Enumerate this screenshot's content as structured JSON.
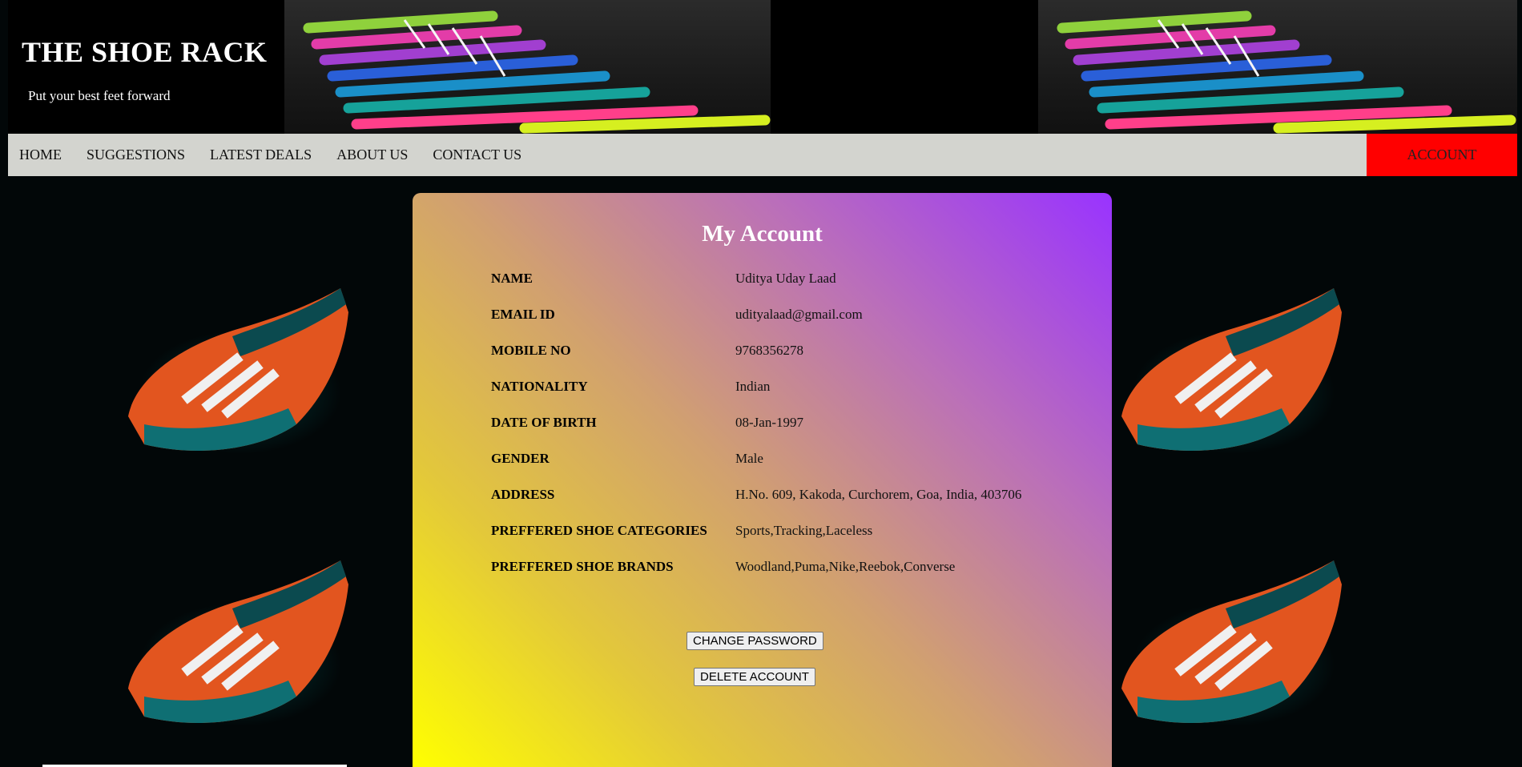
{
  "header": {
    "title": "THE SHOE RACK",
    "tagline": "Put your best feet forward"
  },
  "nav": {
    "items": [
      {
        "label": "HOME"
      },
      {
        "label": "SUGGESTIONS"
      },
      {
        "label": "LATEST DEALS"
      },
      {
        "label": "ABOUT US"
      },
      {
        "label": "CONTACT US"
      }
    ],
    "account_label": "ACCOUNT"
  },
  "account": {
    "title": "My Account",
    "fields": [
      {
        "label": "NAME",
        "value": "Uditya Uday Laad"
      },
      {
        "label": "EMAIL ID",
        "value": "udityalaad@gmail.com"
      },
      {
        "label": "MOBILE NO",
        "value": "9768356278"
      },
      {
        "label": "NATIONALITY",
        "value": "Indian"
      },
      {
        "label": "DATE OF BIRTH",
        "value": "08-Jan-1997"
      },
      {
        "label": "GENDER",
        "value": "Male"
      },
      {
        "label": "ADDRESS",
        "value": "H.No. 609, Kakoda, Curchorem, Goa, India, 403706"
      },
      {
        "label": "PREFFERED SHOE CATEGORIES",
        "value": "Sports,Tracking,Laceless"
      },
      {
        "label": "PREFFERED SHOE BRANDS",
        "value": "Woodland,Puma,Nike,Reebok,Converse"
      }
    ],
    "change_password_label": "CHANGE PASSWORD",
    "delete_account_label": "DELETE ACCOUNT"
  },
  "colors": {
    "nav_background": "#d3d4cf",
    "account_button": "#ff0000",
    "card_gradient_start": "#9933ff",
    "card_gradient_end": "#ffff00"
  }
}
